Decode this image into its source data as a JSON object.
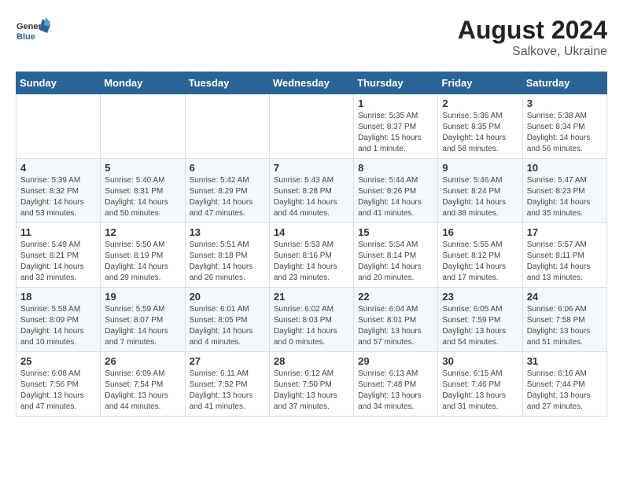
{
  "header": {
    "logo_general": "General",
    "logo_blue": "Blue",
    "title": "August 2024",
    "subtitle": "Salkove, Ukraine"
  },
  "days_of_week": [
    "Sunday",
    "Monday",
    "Tuesday",
    "Wednesday",
    "Thursday",
    "Friday",
    "Saturday"
  ],
  "weeks": [
    [
      {
        "num": "",
        "info": ""
      },
      {
        "num": "",
        "info": ""
      },
      {
        "num": "",
        "info": ""
      },
      {
        "num": "",
        "info": ""
      },
      {
        "num": "1",
        "info": "Sunrise: 5:35 AM\nSunset: 8:37 PM\nDaylight: 15 hours and 1 minute."
      },
      {
        "num": "2",
        "info": "Sunrise: 5:36 AM\nSunset: 8:35 PM\nDaylight: 14 hours and 58 minutes."
      },
      {
        "num": "3",
        "info": "Sunrise: 5:38 AM\nSunset: 8:34 PM\nDaylight: 14 hours and 56 minutes."
      }
    ],
    [
      {
        "num": "4",
        "info": "Sunrise: 5:39 AM\nSunset: 8:32 PM\nDaylight: 14 hours and 53 minutes."
      },
      {
        "num": "5",
        "info": "Sunrise: 5:40 AM\nSunset: 8:31 PM\nDaylight: 14 hours and 50 minutes."
      },
      {
        "num": "6",
        "info": "Sunrise: 5:42 AM\nSunset: 8:29 PM\nDaylight: 14 hours and 47 minutes."
      },
      {
        "num": "7",
        "info": "Sunrise: 5:43 AM\nSunset: 8:28 PM\nDaylight: 14 hours and 44 minutes."
      },
      {
        "num": "8",
        "info": "Sunrise: 5:44 AM\nSunset: 8:26 PM\nDaylight: 14 hours and 41 minutes."
      },
      {
        "num": "9",
        "info": "Sunrise: 5:46 AM\nSunset: 8:24 PM\nDaylight: 14 hours and 38 minutes."
      },
      {
        "num": "10",
        "info": "Sunrise: 5:47 AM\nSunset: 8:23 PM\nDaylight: 14 hours and 35 minutes."
      }
    ],
    [
      {
        "num": "11",
        "info": "Sunrise: 5:49 AM\nSunset: 8:21 PM\nDaylight: 14 hours and 32 minutes."
      },
      {
        "num": "12",
        "info": "Sunrise: 5:50 AM\nSunset: 8:19 PM\nDaylight: 14 hours and 29 minutes."
      },
      {
        "num": "13",
        "info": "Sunrise: 5:51 AM\nSunset: 8:18 PM\nDaylight: 14 hours and 26 minutes."
      },
      {
        "num": "14",
        "info": "Sunrise: 5:53 AM\nSunset: 8:16 PM\nDaylight: 14 hours and 23 minutes."
      },
      {
        "num": "15",
        "info": "Sunrise: 5:54 AM\nSunset: 8:14 PM\nDaylight: 14 hours and 20 minutes."
      },
      {
        "num": "16",
        "info": "Sunrise: 5:55 AM\nSunset: 8:12 PM\nDaylight: 14 hours and 17 minutes."
      },
      {
        "num": "17",
        "info": "Sunrise: 5:57 AM\nSunset: 8:11 PM\nDaylight: 14 hours and 13 minutes."
      }
    ],
    [
      {
        "num": "18",
        "info": "Sunrise: 5:58 AM\nSunset: 8:09 PM\nDaylight: 14 hours and 10 minutes."
      },
      {
        "num": "19",
        "info": "Sunrise: 5:59 AM\nSunset: 8:07 PM\nDaylight: 14 hours and 7 minutes."
      },
      {
        "num": "20",
        "info": "Sunrise: 6:01 AM\nSunset: 8:05 PM\nDaylight: 14 hours and 4 minutes."
      },
      {
        "num": "21",
        "info": "Sunrise: 6:02 AM\nSunset: 8:03 PM\nDaylight: 14 hours and 0 minutes."
      },
      {
        "num": "22",
        "info": "Sunrise: 6:04 AM\nSunset: 8:01 PM\nDaylight: 13 hours and 57 minutes."
      },
      {
        "num": "23",
        "info": "Sunrise: 6:05 AM\nSunset: 7:59 PM\nDaylight: 13 hours and 54 minutes."
      },
      {
        "num": "24",
        "info": "Sunrise: 6:06 AM\nSunset: 7:58 PM\nDaylight: 13 hours and 51 minutes."
      }
    ],
    [
      {
        "num": "25",
        "info": "Sunrise: 6:08 AM\nSunset: 7:56 PM\nDaylight: 13 hours and 47 minutes."
      },
      {
        "num": "26",
        "info": "Sunrise: 6:09 AM\nSunset: 7:54 PM\nDaylight: 13 hours and 44 minutes."
      },
      {
        "num": "27",
        "info": "Sunrise: 6:11 AM\nSunset: 7:52 PM\nDaylight: 13 hours and 41 minutes."
      },
      {
        "num": "28",
        "info": "Sunrise: 6:12 AM\nSunset: 7:50 PM\nDaylight: 13 hours and 37 minutes."
      },
      {
        "num": "29",
        "info": "Sunrise: 6:13 AM\nSunset: 7:48 PM\nDaylight: 13 hours and 34 minutes."
      },
      {
        "num": "30",
        "info": "Sunrise: 6:15 AM\nSunset: 7:46 PM\nDaylight: 13 hours and 31 minutes."
      },
      {
        "num": "31",
        "info": "Sunrise: 6:16 AM\nSunset: 7:44 PM\nDaylight: 13 hours and 27 minutes."
      }
    ]
  ]
}
